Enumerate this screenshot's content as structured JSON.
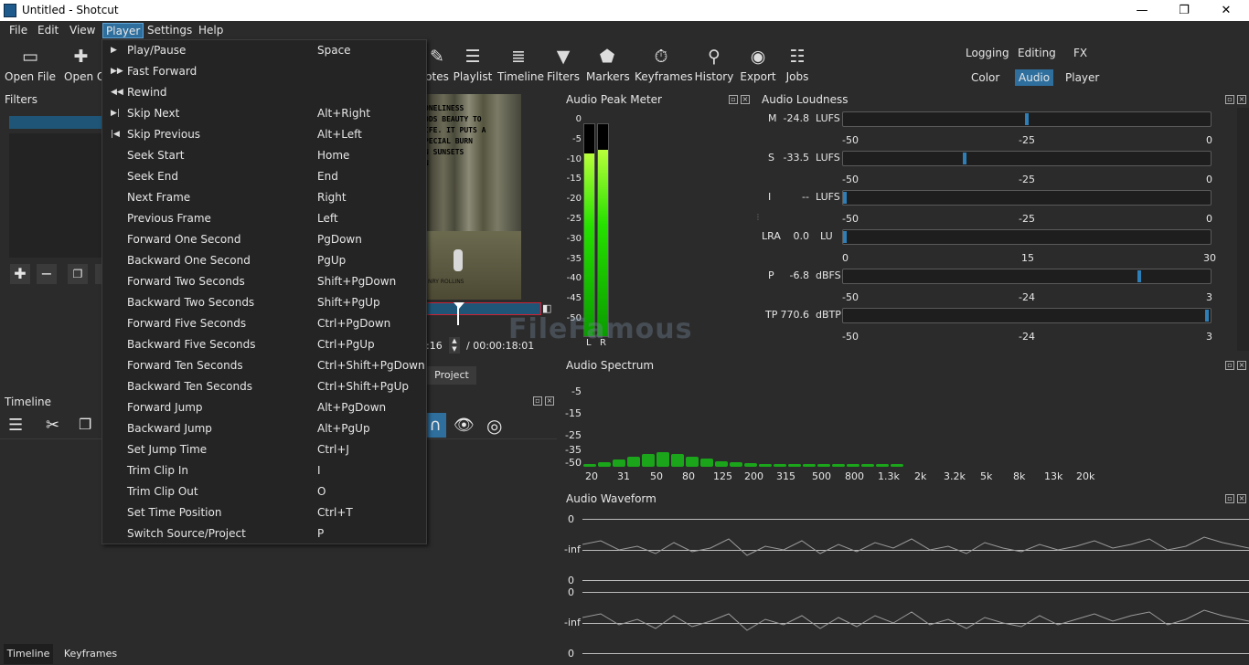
{
  "window": {
    "title": "Untitled - Shotcut",
    "minimize": "—",
    "restore": "❐",
    "close": "✕"
  },
  "menubar": [
    "File",
    "Edit",
    "View",
    "Player",
    "Settings",
    "Help"
  ],
  "toolbar": {
    "left": [
      {
        "label": "Open File",
        "icon": "folder-icon"
      },
      {
        "label": "Open Ot",
        "icon": "open-other-icon"
      }
    ],
    "right": [
      {
        "label": "otes",
        "icon": "notes-icon"
      },
      {
        "label": "Playlist",
        "icon": "playlist-icon"
      },
      {
        "label": "Timeline",
        "icon": "timeline-icon"
      },
      {
        "label": "Filters",
        "icon": "filter-icon"
      },
      {
        "label": "Markers",
        "icon": "marker-icon"
      },
      {
        "label": "Keyframes",
        "icon": "keyframes-icon"
      },
      {
        "label": "History",
        "icon": "history-icon"
      },
      {
        "label": "Export",
        "icon": "export-icon"
      },
      {
        "label": "Jobs",
        "icon": "jobs-icon"
      }
    ],
    "layouts_top": [
      "Logging",
      "Editing",
      "FX"
    ],
    "layouts_bottom": [
      "Color",
      "Audio",
      "Player"
    ],
    "active_layout": "Audio"
  },
  "filters": {
    "title": "Filters"
  },
  "timeline": {
    "title": "Timeline",
    "bottom_tabs": [
      "Timeline",
      "Keyframes"
    ]
  },
  "player": {
    "time_current": ":16",
    "time_total": "/ 00:00:18:01",
    "project_tab": "Project",
    "video_text": "ONELINESS\nODS BEAUTY TO\nIFE. IT PUTS A\nPECIAL BURN\nN SUNSETS\nN",
    "video_footer": "NRY ROLLINS"
  },
  "player_menu": [
    {
      "label": "Play/Pause",
      "shortcut": "Space",
      "icon": "play-icon"
    },
    {
      "label": "Fast Forward",
      "shortcut": "",
      "icon": "fast-forward-icon"
    },
    {
      "label": "Rewind",
      "shortcut": "",
      "icon": "rewind-icon"
    },
    {
      "label": "Skip Next",
      "shortcut": "Alt+Right",
      "icon": "skip-next-icon"
    },
    {
      "label": "Skip Previous",
      "shortcut": "Alt+Left",
      "icon": "skip-previous-icon"
    },
    {
      "label": "Seek Start",
      "shortcut": "Home",
      "icon": ""
    },
    {
      "label": "Seek End",
      "shortcut": "End",
      "icon": ""
    },
    {
      "label": "Next Frame",
      "shortcut": "Right",
      "icon": ""
    },
    {
      "label": "Previous Frame",
      "shortcut": "Left",
      "icon": ""
    },
    {
      "label": "Forward One Second",
      "shortcut": "PgDown",
      "icon": ""
    },
    {
      "label": "Backward One Second",
      "shortcut": "PgUp",
      "icon": ""
    },
    {
      "label": "Forward Two Seconds",
      "shortcut": "Shift+PgDown",
      "icon": ""
    },
    {
      "label": "Backward Two Seconds",
      "shortcut": "Shift+PgUp",
      "icon": ""
    },
    {
      "label": "Forward Five Seconds",
      "shortcut": "Ctrl+PgDown",
      "icon": ""
    },
    {
      "label": "Backward Five Seconds",
      "shortcut": "Ctrl+PgUp",
      "icon": ""
    },
    {
      "label": "Forward Ten Seconds",
      "shortcut": "Ctrl+Shift+PgDown",
      "icon": ""
    },
    {
      "label": "Backward Ten Seconds",
      "shortcut": "Ctrl+Shift+PgUp",
      "icon": ""
    },
    {
      "label": "Forward Jump",
      "shortcut": "Alt+PgDown",
      "icon": ""
    },
    {
      "label": "Backward Jump",
      "shortcut": "Alt+PgUp",
      "icon": ""
    },
    {
      "label": "Set Jump Time",
      "shortcut": "Ctrl+J",
      "icon": ""
    },
    {
      "label": "Trim Clip In",
      "shortcut": "I",
      "icon": ""
    },
    {
      "label": "Trim Clip Out",
      "shortcut": "O",
      "icon": ""
    },
    {
      "label": "Set Time Position",
      "shortcut": "Ctrl+T",
      "icon": ""
    },
    {
      "label": "Switch Source/Project",
      "shortcut": "P",
      "icon": ""
    }
  ],
  "peak_meter": {
    "title": "Audio Peak Meter",
    "scale": [
      "0",
      "-5",
      "-10",
      "-15",
      "-20",
      "-25",
      "-30",
      "-35",
      "-40",
      "-45",
      "-50"
    ],
    "channels": [
      "L",
      "R"
    ],
    "levels_db": [
      -7,
      -6
    ]
  },
  "loudness": {
    "title": "Audio Loudness",
    "rows": [
      {
        "label": "M",
        "value": "-24.8",
        "unit": "LUFS",
        "scale": [
          "-50",
          "-25",
          "0"
        ],
        "level": 0.5
      },
      {
        "label": "S",
        "value": "-33.5",
        "unit": "LUFS",
        "scale": [
          "-50",
          "-25",
          "0"
        ],
        "level": 0.33
      },
      {
        "label": "I",
        "value": "--",
        "unit": "LUFS",
        "scale": [
          "-50",
          "-25",
          "0"
        ],
        "level": 0.0
      },
      {
        "label": "LRA",
        "value": "0.0",
        "unit": "LU",
        "scale": [
          "0",
          "15",
          "30"
        ],
        "level": 0.0
      },
      {
        "label": "P",
        "value": "-6.8",
        "unit": "dBFS",
        "scale": [
          "-50",
          "-24",
          "3"
        ],
        "level": 0.81
      },
      {
        "label": "TP",
        "value": "770.6",
        "unit": "dBTP",
        "scale": [
          "-50",
          "-24",
          "3"
        ],
        "level": 0.995
      }
    ]
  },
  "spectrum": {
    "title": "Audio Spectrum",
    "yscale": [
      "-5",
      "-15",
      "-25",
      "-35",
      "-50"
    ],
    "xscale": [
      "20",
      "31",
      "50",
      "80",
      "125",
      "200",
      "315",
      "500",
      "800",
      "1.3k",
      "2k",
      "3.2k",
      "5k",
      "8k",
      "13k",
      "20k"
    ],
    "levels": [
      0.1,
      0.2,
      0.3,
      0.45,
      0.55,
      0.62,
      0.58,
      0.45,
      0.35,
      0.25,
      0.2,
      0.15,
      0.12,
      0.1,
      0.08,
      0.07,
      0.06,
      0.05,
      0.05,
      0.04,
      0.04,
      0.03
    ]
  },
  "waveform": {
    "title": "Audio Waveform",
    "labels": [
      "0",
      "-inf",
      "0",
      "0",
      "-inf",
      "0"
    ]
  },
  "watermark": "FileFamous"
}
